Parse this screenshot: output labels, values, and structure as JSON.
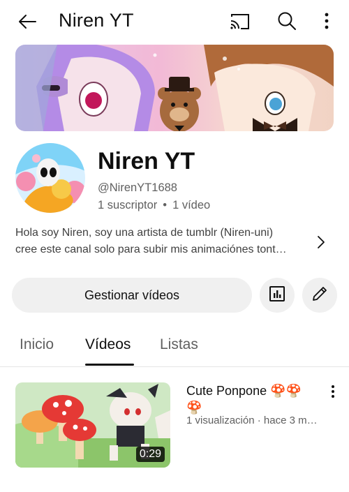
{
  "header": {
    "title": "Niren YT",
    "icons": [
      "back-arrow-icon",
      "cast-icon",
      "search-icon",
      "more-vert-icon"
    ]
  },
  "channel": {
    "name": "Niren YT",
    "handle": "@NirenYT1688",
    "subscribers": "1 suscriptor",
    "separator": "•",
    "videos_count": "1 vídeo",
    "description_line1": "Hola soy Niren, soy una artista de tumblr (Niren-uni)",
    "description_line2": "cree este canal solo para subir mis animaciónes tont…"
  },
  "actions": {
    "manage_label": "Gestionar vídeos"
  },
  "tabs": [
    {
      "label": "Inicio",
      "active": false
    },
    {
      "label": "Vídeos",
      "active": true
    },
    {
      "label": "Listas",
      "active": false
    }
  ],
  "videos": [
    {
      "title": "Cute Ponpone 🍄🍄🍄",
      "views": "1 visualización",
      "separator": "·",
      "age": "hace 3 m…",
      "duration": "0:29"
    }
  ]
}
